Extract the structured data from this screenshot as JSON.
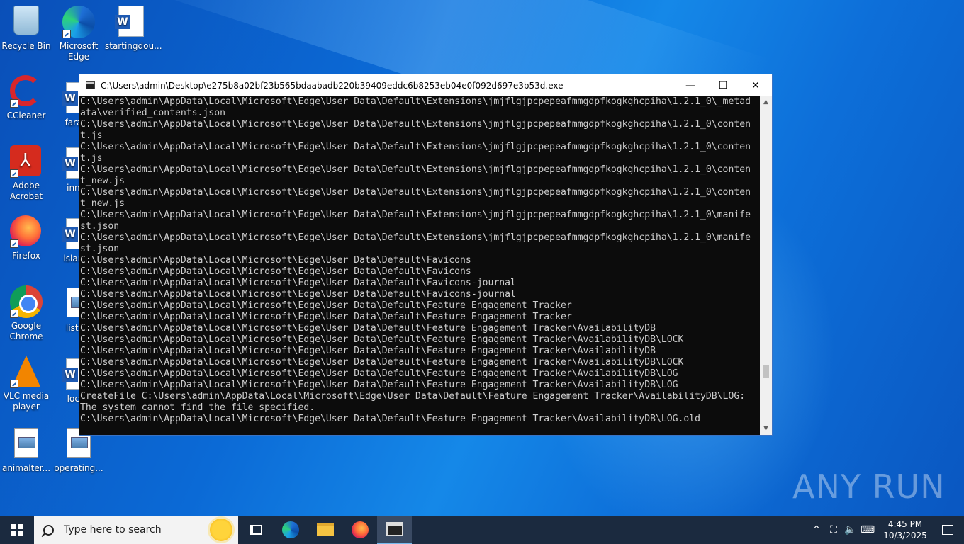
{
  "desktop_icons": [
    {
      "label": "Recycle Bin",
      "icon": "recycle-bin-icon"
    },
    {
      "label": "Microsoft Edge",
      "icon": "edge-icon"
    },
    {
      "label": "startingdou...",
      "icon": "word-doc-icon"
    },
    {
      "label": "CCleaner",
      "icon": "ccleaner-icon"
    },
    {
      "label": "farage",
      "icon": "word-doc-icon"
    },
    {
      "label": "Adobe Acrobat",
      "icon": "acrobat-icon"
    },
    {
      "label": "innqu",
      "icon": "word-doc-icon"
    },
    {
      "label": "Firefox",
      "icon": "firefox-icon"
    },
    {
      "label": "islandp",
      "icon": "word-doc-icon"
    },
    {
      "label": "Google Chrome",
      "icon": "chrome-icon"
    },
    {
      "label": "listing",
      "icon": "image-file-icon"
    },
    {
      "label": "VLC media player",
      "icon": "vlc-icon"
    },
    {
      "label": "locati",
      "icon": "word-doc-icon"
    },
    {
      "label": "animalter...",
      "icon": "image-file-icon"
    },
    {
      "label": "operating...",
      "icon": "image-file-icon"
    }
  ],
  "window": {
    "title": "C:\\Users\\admin\\Desktop\\e275b8a02bf23b565bdaabadb220b39409eddc6b8253eb04e0f092d697e3b53d.exe",
    "minimize": "—",
    "maximize": "☐",
    "close": "✕"
  },
  "console_lines": [
    "C:\\Users\\admin\\AppData\\Local\\Microsoft\\Edge\\User Data\\Default\\Extensions\\jmjflgjpcpepeafmmgdpfkogkghcpiha\\1.2.1_0\\_metad",
    "ata\\verified_contents.json",
    "C:\\Users\\admin\\AppData\\Local\\Microsoft\\Edge\\User Data\\Default\\Extensions\\jmjflgjpcpepeafmmgdpfkogkghcpiha\\1.2.1_0\\conten",
    "t.js",
    "C:\\Users\\admin\\AppData\\Local\\Microsoft\\Edge\\User Data\\Default\\Extensions\\jmjflgjpcpepeafmmgdpfkogkghcpiha\\1.2.1_0\\conten",
    "t.js",
    "C:\\Users\\admin\\AppData\\Local\\Microsoft\\Edge\\User Data\\Default\\Extensions\\jmjflgjpcpepeafmmgdpfkogkghcpiha\\1.2.1_0\\conten",
    "t_new.js",
    "C:\\Users\\admin\\AppData\\Local\\Microsoft\\Edge\\User Data\\Default\\Extensions\\jmjflgjpcpepeafmmgdpfkogkghcpiha\\1.2.1_0\\conten",
    "t_new.js",
    "C:\\Users\\admin\\AppData\\Local\\Microsoft\\Edge\\User Data\\Default\\Extensions\\jmjflgjpcpepeafmmgdpfkogkghcpiha\\1.2.1_0\\manife",
    "st.json",
    "C:\\Users\\admin\\AppData\\Local\\Microsoft\\Edge\\User Data\\Default\\Extensions\\jmjflgjpcpepeafmmgdpfkogkghcpiha\\1.2.1_0\\manife",
    "st.json",
    "C:\\Users\\admin\\AppData\\Local\\Microsoft\\Edge\\User Data\\Default\\Favicons",
    "C:\\Users\\admin\\AppData\\Local\\Microsoft\\Edge\\User Data\\Default\\Favicons",
    "C:\\Users\\admin\\AppData\\Local\\Microsoft\\Edge\\User Data\\Default\\Favicons-journal",
    "C:\\Users\\admin\\AppData\\Local\\Microsoft\\Edge\\User Data\\Default\\Favicons-journal",
    "C:\\Users\\admin\\AppData\\Local\\Microsoft\\Edge\\User Data\\Default\\Feature Engagement Tracker",
    "C:\\Users\\admin\\AppData\\Local\\Microsoft\\Edge\\User Data\\Default\\Feature Engagement Tracker",
    "C:\\Users\\admin\\AppData\\Local\\Microsoft\\Edge\\User Data\\Default\\Feature Engagement Tracker\\AvailabilityDB",
    "C:\\Users\\admin\\AppData\\Local\\Microsoft\\Edge\\User Data\\Default\\Feature Engagement Tracker\\AvailabilityDB\\LOCK",
    "C:\\Users\\admin\\AppData\\Local\\Microsoft\\Edge\\User Data\\Default\\Feature Engagement Tracker\\AvailabilityDB",
    "C:\\Users\\admin\\AppData\\Local\\Microsoft\\Edge\\User Data\\Default\\Feature Engagement Tracker\\AvailabilityDB\\LOCK",
    "C:\\Users\\admin\\AppData\\Local\\Microsoft\\Edge\\User Data\\Default\\Feature Engagement Tracker\\AvailabilityDB\\LOG",
    "C:\\Users\\admin\\AppData\\Local\\Microsoft\\Edge\\User Data\\Default\\Feature Engagement Tracker\\AvailabilityDB\\LOG",
    "CreateFile C:\\Users\\admin\\AppData\\Local\\Microsoft\\Edge\\User Data\\Default\\Feature Engagement Tracker\\AvailabilityDB\\LOG:",
    "The system cannot find the file specified.",
    "C:\\Users\\admin\\AppData\\Local\\Microsoft\\Edge\\User Data\\Default\\Feature Engagement Tracker\\AvailabilityDB\\LOG.old"
  ],
  "scrollbar": {
    "up": "▲",
    "down": "▼"
  },
  "watermark": "ANY RUN",
  "taskbar": {
    "search_placeholder": "Type here to search",
    "pinned": [
      "task-view",
      "microsoft-edge",
      "file-explorer",
      "firefox",
      "console"
    ],
    "tray_icons": {
      "chevron": "⌃",
      "network": "⛶",
      "volume": "🔈",
      "ime": "⌨"
    },
    "time": "4:45 PM",
    "date": "10/3/2025"
  },
  "colors": {
    "console_bg": "#0c0c0c",
    "console_text": "#cccccc",
    "taskbar_bg": "#1b2a3f",
    "desktop_blue": "#0b6ad6"
  }
}
